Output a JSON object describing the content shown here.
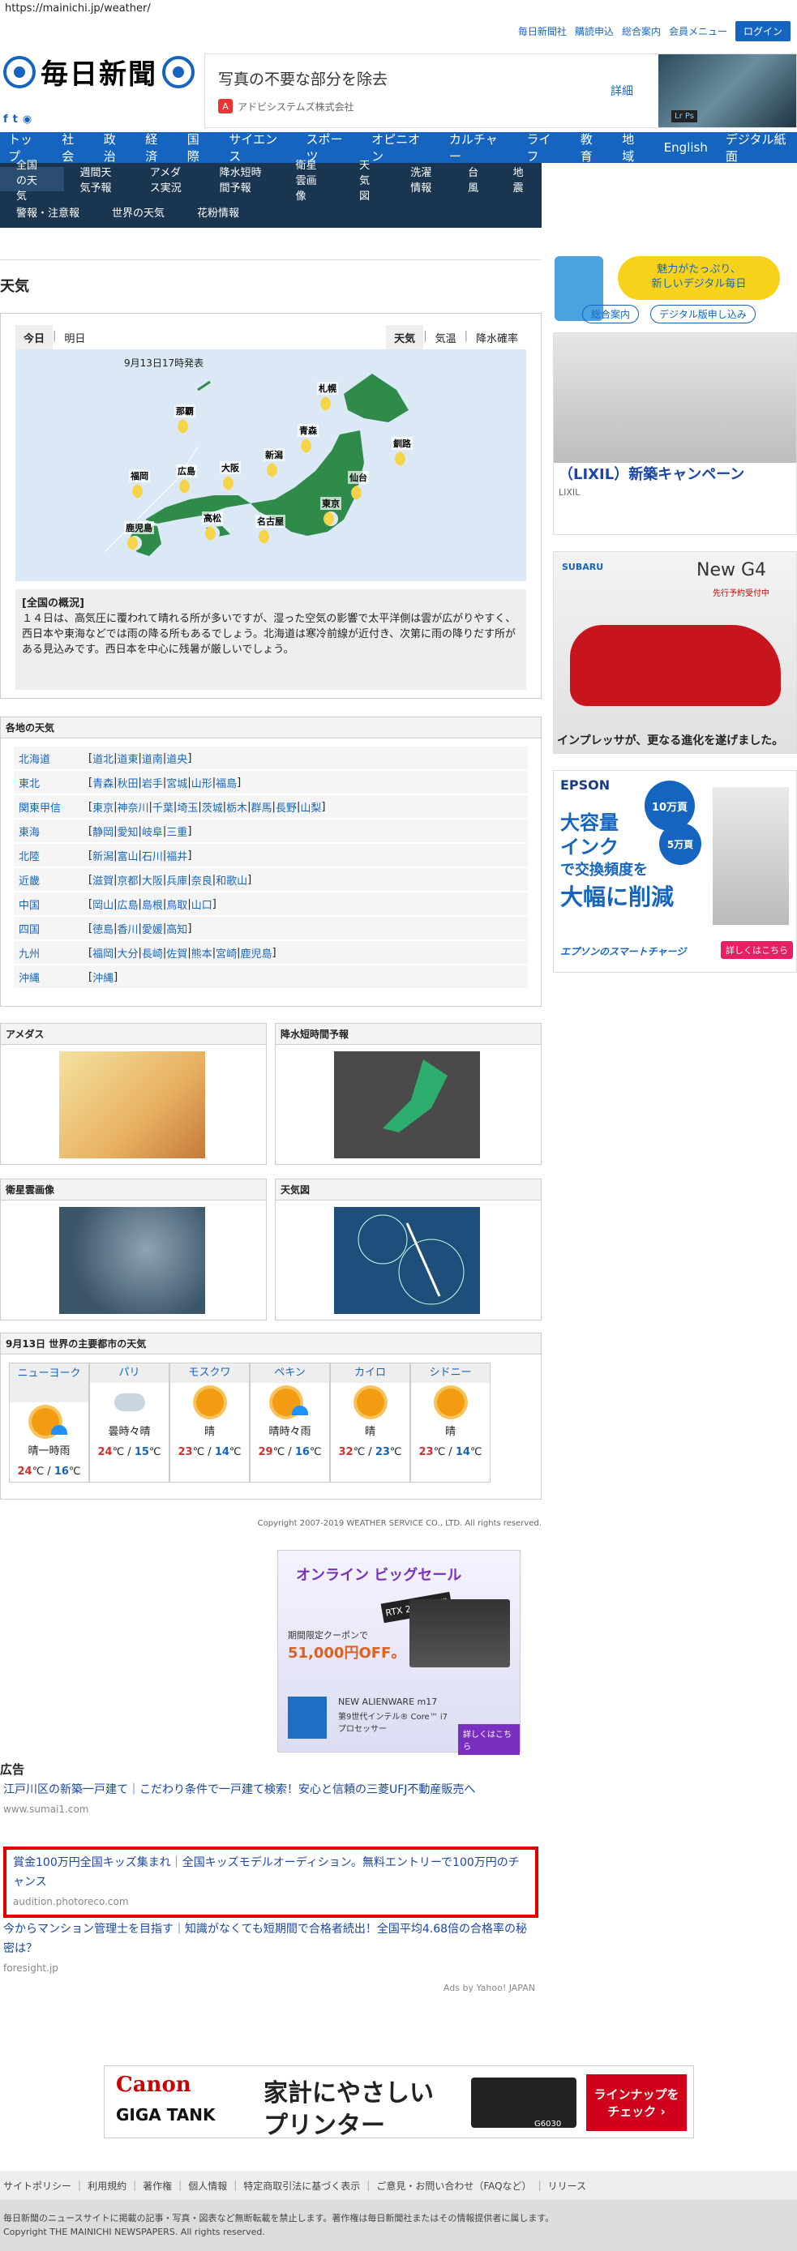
{
  "url": "https://mainichi.jp/weather/",
  "toplinks": [
    "毎日新聞社",
    "購読申込",
    "総合案内",
    "会員メニュー"
  ],
  "login": "ログイン",
  "logo_text": "毎日新聞",
  "top_ad": {
    "title": "写真の不要な部分を除去",
    "sponsor": "アドビシステムズ株式会社",
    "detail": "詳細"
  },
  "nav1": [
    "トップ",
    "社会",
    "政治",
    "経済",
    "国際",
    "サイエンス",
    "スポーツ",
    "オピニオン",
    "カルチャー",
    "ライフ",
    "教育",
    "地域",
    "English",
    "デジタル紙面"
  ],
  "nav2_row1": [
    "全国の天気",
    "週間天気予報",
    "アメダス実況",
    "降水短時間予報",
    "衛星雲画像",
    "天気図",
    "洗濯情報",
    "台風",
    "地震"
  ],
  "nav2_row2": [
    "警報・注意報",
    "世界の天気",
    "花粉情報"
  ],
  "page_title": "天気",
  "tabs_left": [
    "今日",
    "明日"
  ],
  "tabs_right": [
    "天気",
    "気温",
    "降水確率"
  ],
  "map_date": "9月13日17時発表",
  "map_cities": [
    "那覇",
    "札幌",
    "青森",
    "釧路",
    "福岡",
    "広島",
    "大阪",
    "新潟",
    "仙台",
    "東京",
    "鹿児島",
    "高松",
    "名古屋"
  ],
  "gaikyo_title": "[全国の概況]",
  "gaikyo_text": "１４日は、高気圧に覆われて晴れる所が多いですが、湿った空気の影響で太平洋側は雲が広がりやすく、西日本や東海などでは雨の降る所もあるでしょう。北海道は寒冷前線が近付き、次第に雨の降りだす所がある見込みです。西日本を中心に残暑が厳しいでしょう。",
  "regions_title": "各地の天気",
  "regions": [
    {
      "name": "北海道",
      "prefs": [
        "道北",
        "道東",
        "道南",
        "道央"
      ]
    },
    {
      "name": "東北",
      "prefs": [
        "青森",
        "秋田",
        "岩手",
        "宮城",
        "山形",
        "福島"
      ]
    },
    {
      "name": "関東甲信",
      "prefs": [
        "東京",
        "神奈川",
        "千葉",
        "埼玉",
        "茨城",
        "栃木",
        "群馬",
        "長野",
        "山梨"
      ]
    },
    {
      "name": "東海",
      "prefs": [
        "静岡",
        "愛知",
        "岐阜",
        "三重"
      ]
    },
    {
      "name": "北陸",
      "prefs": [
        "新潟",
        "富山",
        "石川",
        "福井"
      ]
    },
    {
      "name": "近畿",
      "prefs": [
        "滋賀",
        "京都",
        "大阪",
        "兵庫",
        "奈良",
        "和歌山"
      ]
    },
    {
      "name": "中国",
      "prefs": [
        "岡山",
        "広島",
        "島根",
        "鳥取",
        "山口"
      ]
    },
    {
      "name": "四国",
      "prefs": [
        "徳島",
        "香川",
        "愛媛",
        "高知"
      ]
    },
    {
      "name": "九州",
      "prefs": [
        "福岡",
        "大分",
        "長崎",
        "佐賀",
        "熊本",
        "宮崎",
        "鹿児島"
      ]
    },
    {
      "name": "沖縄",
      "prefs": [
        "沖縄"
      ]
    }
  ],
  "panels": [
    "アメダス",
    "降水短時間予報",
    "衛星雲画像",
    "天気図"
  ],
  "world_title": "9月13日 世界の主要都市の天気",
  "world": [
    {
      "city": "ニューヨーク",
      "weather": "晴一時雨",
      "hi": "24",
      "lo": "16",
      "icon": "sun-rain"
    },
    {
      "city": "パリ",
      "weather": "曇時々晴",
      "hi": "24",
      "lo": "15",
      "icon": "cloud-sun"
    },
    {
      "city": "モスクワ",
      "weather": "晴",
      "hi": "23",
      "lo": "14",
      "icon": "sun"
    },
    {
      "city": "ペキン",
      "weather": "晴時々雨",
      "hi": "29",
      "lo": "16",
      "icon": "sun-rain"
    },
    {
      "city": "カイロ",
      "weather": "晴",
      "hi": "32",
      "lo": "23",
      "icon": "sun"
    },
    {
      "city": "シドニー",
      "weather": "晴",
      "hi": "23",
      "lo": "14",
      "icon": "sun"
    }
  ],
  "copyright_ws": "Copyright 2007-2019 WEATHER SERVICE CO., LTD. All rights reserved.",
  "sponsor_ad": {
    "title": "オンライン ビッグセール",
    "sub": "RTX 2070 搭載",
    "price": "51,000円OFF。",
    "model": "NEW ALIENWARE m17",
    "cpu": "第9世代インテル® Core™ i7 プロセッサー",
    "cta": "詳しくはこちら",
    "coupon": "期間限定クーポンで"
  },
  "ads_label": "広告",
  "ads": [
    {
      "title": "江戸川区の新築一戸建て｜こだわり条件で一戸建て検索！安心と信頼の三菱UFJ不動産販売へ",
      "src": "www.sumai1.com"
    },
    {
      "title": "賞金100万円全国キッズ集まれ｜全国キッズモデルオーディション。無料エントリーで100万円のチャンス",
      "src": "audition.photoreco.com"
    },
    {
      "title": "今からマンション管理士を目指す｜知識がなくても短期間で合格者続出！全国平均4.68倍の合格率の秘密は？",
      "src": "foresight.jp"
    }
  ],
  "yahoo": "Ads by Yahoo! JAPAN",
  "canon": {
    "brand": "Canon",
    "tagline1": "家計にやさしい",
    "tagline2": "プリンター",
    "sub": "GIGA TANK",
    "model": "G6030",
    "cta": "ラインナップを チェック ›"
  },
  "footer_links": [
    "サイトポリシー",
    "利用規約",
    "著作権",
    "個人情報",
    "特定商取引法に基づく表示",
    "ご意見・お問い合わせ（FAQなど）",
    "リリース"
  ],
  "footer_note": "毎日新聞のニュースサイトに掲載の記事・写真・図表など無断転載を禁止します。著作権は毎日新聞社またはその情報提供者に属します。",
  "footer_copy": "Copyright THE MAINICHI NEWSPAPERS. All rights reserved.",
  "side_ad1": {
    "line1": "魅力がたっぷり、",
    "line2": "新しいデジタル毎日",
    "btn1": "総合案内",
    "btn2": "デジタル版申し込み"
  },
  "side_ad2": {
    "title": "（LIXIL）新築キャンペーン",
    "brand": "LIXIL"
  },
  "side_ad3": {
    "brand": "SUBARU",
    "model": "New G4",
    "note": "先行予約受付中",
    "text": "インプレッサが、更なる進化を遂げました。"
  },
  "side_ad4": {
    "brand": "EPSON",
    "l1": "大容量",
    "l2": "インク",
    "l3": "で交換頻度を",
    "l4": "大幅に削減",
    "b1": "10万頁",
    "b2": "5万頁",
    "foot": "エプソンのスマートチャージ",
    "cta": "詳しくはこちら"
  }
}
